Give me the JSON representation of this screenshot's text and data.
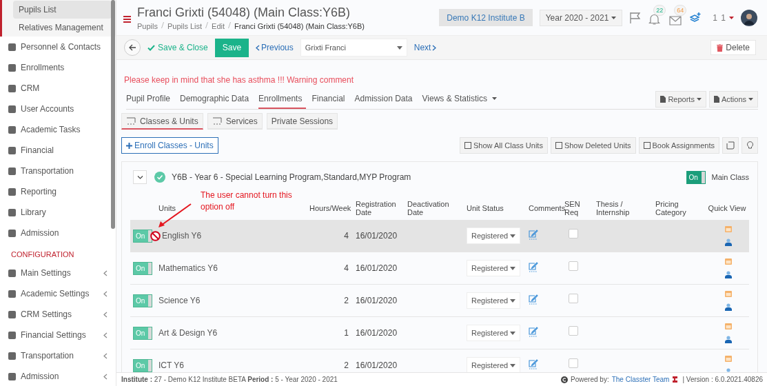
{
  "sidebar": {
    "submenu": [
      {
        "label": "Pupils List",
        "selected": true
      },
      {
        "label": "Relatives Management",
        "selected": false
      }
    ],
    "items": [
      {
        "label": "Personnel & Contacts"
      },
      {
        "label": "Enrollments"
      },
      {
        "label": "CRM"
      },
      {
        "label": "User Accounts"
      },
      {
        "label": "Academic Tasks"
      },
      {
        "label": "Financial"
      },
      {
        "label": "Transportation"
      },
      {
        "label": "Reporting"
      },
      {
        "label": "Library"
      },
      {
        "label": "Admission"
      }
    ],
    "section_title": "CONFIGURATION",
    "config_items": [
      {
        "label": "Main Settings"
      },
      {
        "label": "Academic Settings"
      },
      {
        "label": "CRM Settings"
      },
      {
        "label": "Financial Settings"
      },
      {
        "label": "Transportation"
      },
      {
        "label": "Admission"
      }
    ]
  },
  "header": {
    "title": "Franci Grixti (54048) (Main Class:Y6B)",
    "breadcrumbs": [
      "Pupils",
      "Pupils List",
      "Edit",
      "Franci Grixti (54048) (Main Class:Y6B)"
    ],
    "institute": "Demo K12 Institute B",
    "year": "Year 2020 - 2021",
    "notifications_badge": "22",
    "messages_badge": "64",
    "user": "1 1"
  },
  "toolbar": {
    "save_close": "Save & Close",
    "save": "Save",
    "previous": "Previous",
    "pupil_select": "Grixti Franci",
    "next": "Next",
    "delete": "Delete"
  },
  "warning": "Please keep in mind that she has asthma !!! Warning comment",
  "tabs": [
    {
      "label": "Pupil Profile",
      "selected": false,
      "dropdown": false
    },
    {
      "label": "Demographic Data",
      "selected": false,
      "dropdown": false
    },
    {
      "label": "Enrollments",
      "selected": true,
      "dropdown": false
    },
    {
      "label": "Financial",
      "selected": false,
      "dropdown": false
    },
    {
      "label": "Admission Data",
      "selected": false,
      "dropdown": false
    },
    {
      "label": "Views & Statistics",
      "selected": false,
      "dropdown": true
    }
  ],
  "tab_actions": [
    "Reports",
    "Actions"
  ],
  "subtabs": [
    {
      "label": "Classes & Units",
      "selected": true
    },
    {
      "label": "Services",
      "selected": false
    },
    {
      "label": "Private Sessions",
      "selected": false
    }
  ],
  "enroll_button": "Enroll Classes - Units",
  "unit_actions": [
    "Show All Class Units",
    "Show Deleted Units",
    "Book Assignments"
  ],
  "class": {
    "title": "Y6B - Year 6 - Special Learning Program,Standard,MYP Program",
    "main_class_on": true,
    "toggle_label": "On",
    "main_class_label": "Main Class"
  },
  "annotation": "The user cannot turn this option off",
  "columns": [
    "Units",
    "Hours/Week",
    "Registration Date",
    "Deactivation Date",
    "Unit Status",
    "Comments",
    "SEN Req",
    "Thesis / Internship",
    "Pricing Category",
    "Quick View"
  ],
  "rows": [
    {
      "on": true,
      "toggle_label": "On",
      "locked": true,
      "selected": true,
      "unit": "English Y6",
      "hours": "4",
      "registration_date": "16/01/2020",
      "status": "Registered",
      "sen_req": false
    },
    {
      "on": true,
      "toggle_label": "On",
      "locked": false,
      "selected": false,
      "unit": "Mathematics Y6",
      "hours": "4",
      "registration_date": "16/01/2020",
      "status": "Registered",
      "sen_req": false
    },
    {
      "on": true,
      "toggle_label": "On",
      "locked": false,
      "selected": false,
      "unit": "Science Y6",
      "hours": "2",
      "registration_date": "16/01/2020",
      "status": "Registered",
      "sen_req": false
    },
    {
      "on": true,
      "toggle_label": "On",
      "locked": false,
      "selected": false,
      "unit": "Art & Design Y6",
      "hours": "1",
      "registration_date": "16/01/2020",
      "status": "Registered",
      "sen_req": false
    },
    {
      "on": true,
      "toggle_label": "On",
      "locked": false,
      "selected": false,
      "unit": "ICT Y6",
      "hours": "2",
      "registration_date": "16/01/2020",
      "status": "Registered",
      "sen_req": false
    }
  ],
  "footer": {
    "info": "**Institute :** 27 - Demo K12 Institute BETA **Period :** 5 - Year 2020 - 2021",
    "powered": "Powered by:",
    "team_link": "The Classter Team",
    "version": "| Version : 6.0.2021.40826"
  }
}
